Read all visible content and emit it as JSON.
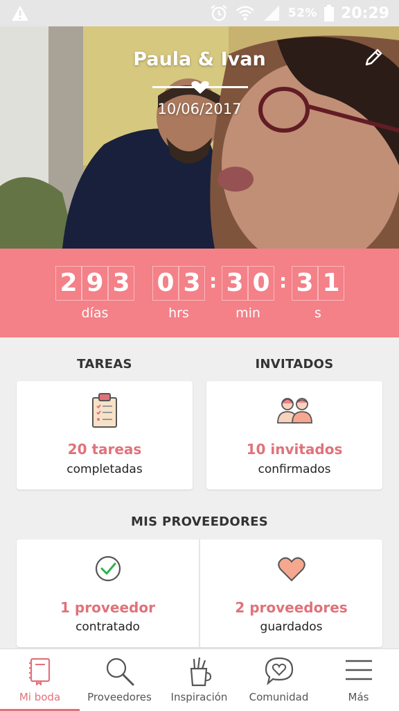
{
  "statusbar": {
    "battery_percent": "52%",
    "time": "20:29",
    "icons": [
      "warning-icon",
      "alarm-icon",
      "wifi-icon",
      "signal-icon",
      "battery-icon"
    ]
  },
  "hero": {
    "couple_names": "Paula & Ivan",
    "wedding_date": "10/06/2017",
    "edit_icon": "pencil-icon"
  },
  "countdown": {
    "days": [
      "2",
      "9",
      "3"
    ],
    "hours": [
      "0",
      "3"
    ],
    "minutes": [
      "3",
      "0"
    ],
    "seconds": [
      "3",
      "1"
    ],
    "labels": {
      "days": "días",
      "hours": "hrs",
      "minutes": "min",
      "seconds": "s"
    }
  },
  "tasks": {
    "title": "TAREAS",
    "count": "20 tareas",
    "sub": "completadas",
    "icon": "clipboard-checklist-icon"
  },
  "guests": {
    "title": "INVITADOS",
    "count": "10 invitados",
    "sub": "confirmados",
    "icon": "couple-guests-icon"
  },
  "vendors": {
    "title": "MIS PROVEEDORES",
    "hired": {
      "count": "1 proveedor",
      "sub": "contratado",
      "icon": "check-circle-icon"
    },
    "saved": {
      "count": "2 proveedores",
      "sub": "guardados",
      "icon": "heart-icon"
    }
  },
  "bottom_nav": [
    {
      "label": "Mi boda",
      "icon": "notebook-icon",
      "active": true
    },
    {
      "label": "Proveedores",
      "icon": "search-icon",
      "active": false
    },
    {
      "label": "Inspiración",
      "icon": "pen-cup-icon",
      "active": false
    },
    {
      "label": "Comunidad",
      "icon": "chat-heart-icon",
      "active": false
    },
    {
      "label": "Más",
      "icon": "menu-icon",
      "active": false
    }
  ],
  "colors": {
    "accent": "#e0727a",
    "countdown_bg": "#f48088",
    "heart_fill": "#f6a78f",
    "check_green": "#2db34a"
  }
}
